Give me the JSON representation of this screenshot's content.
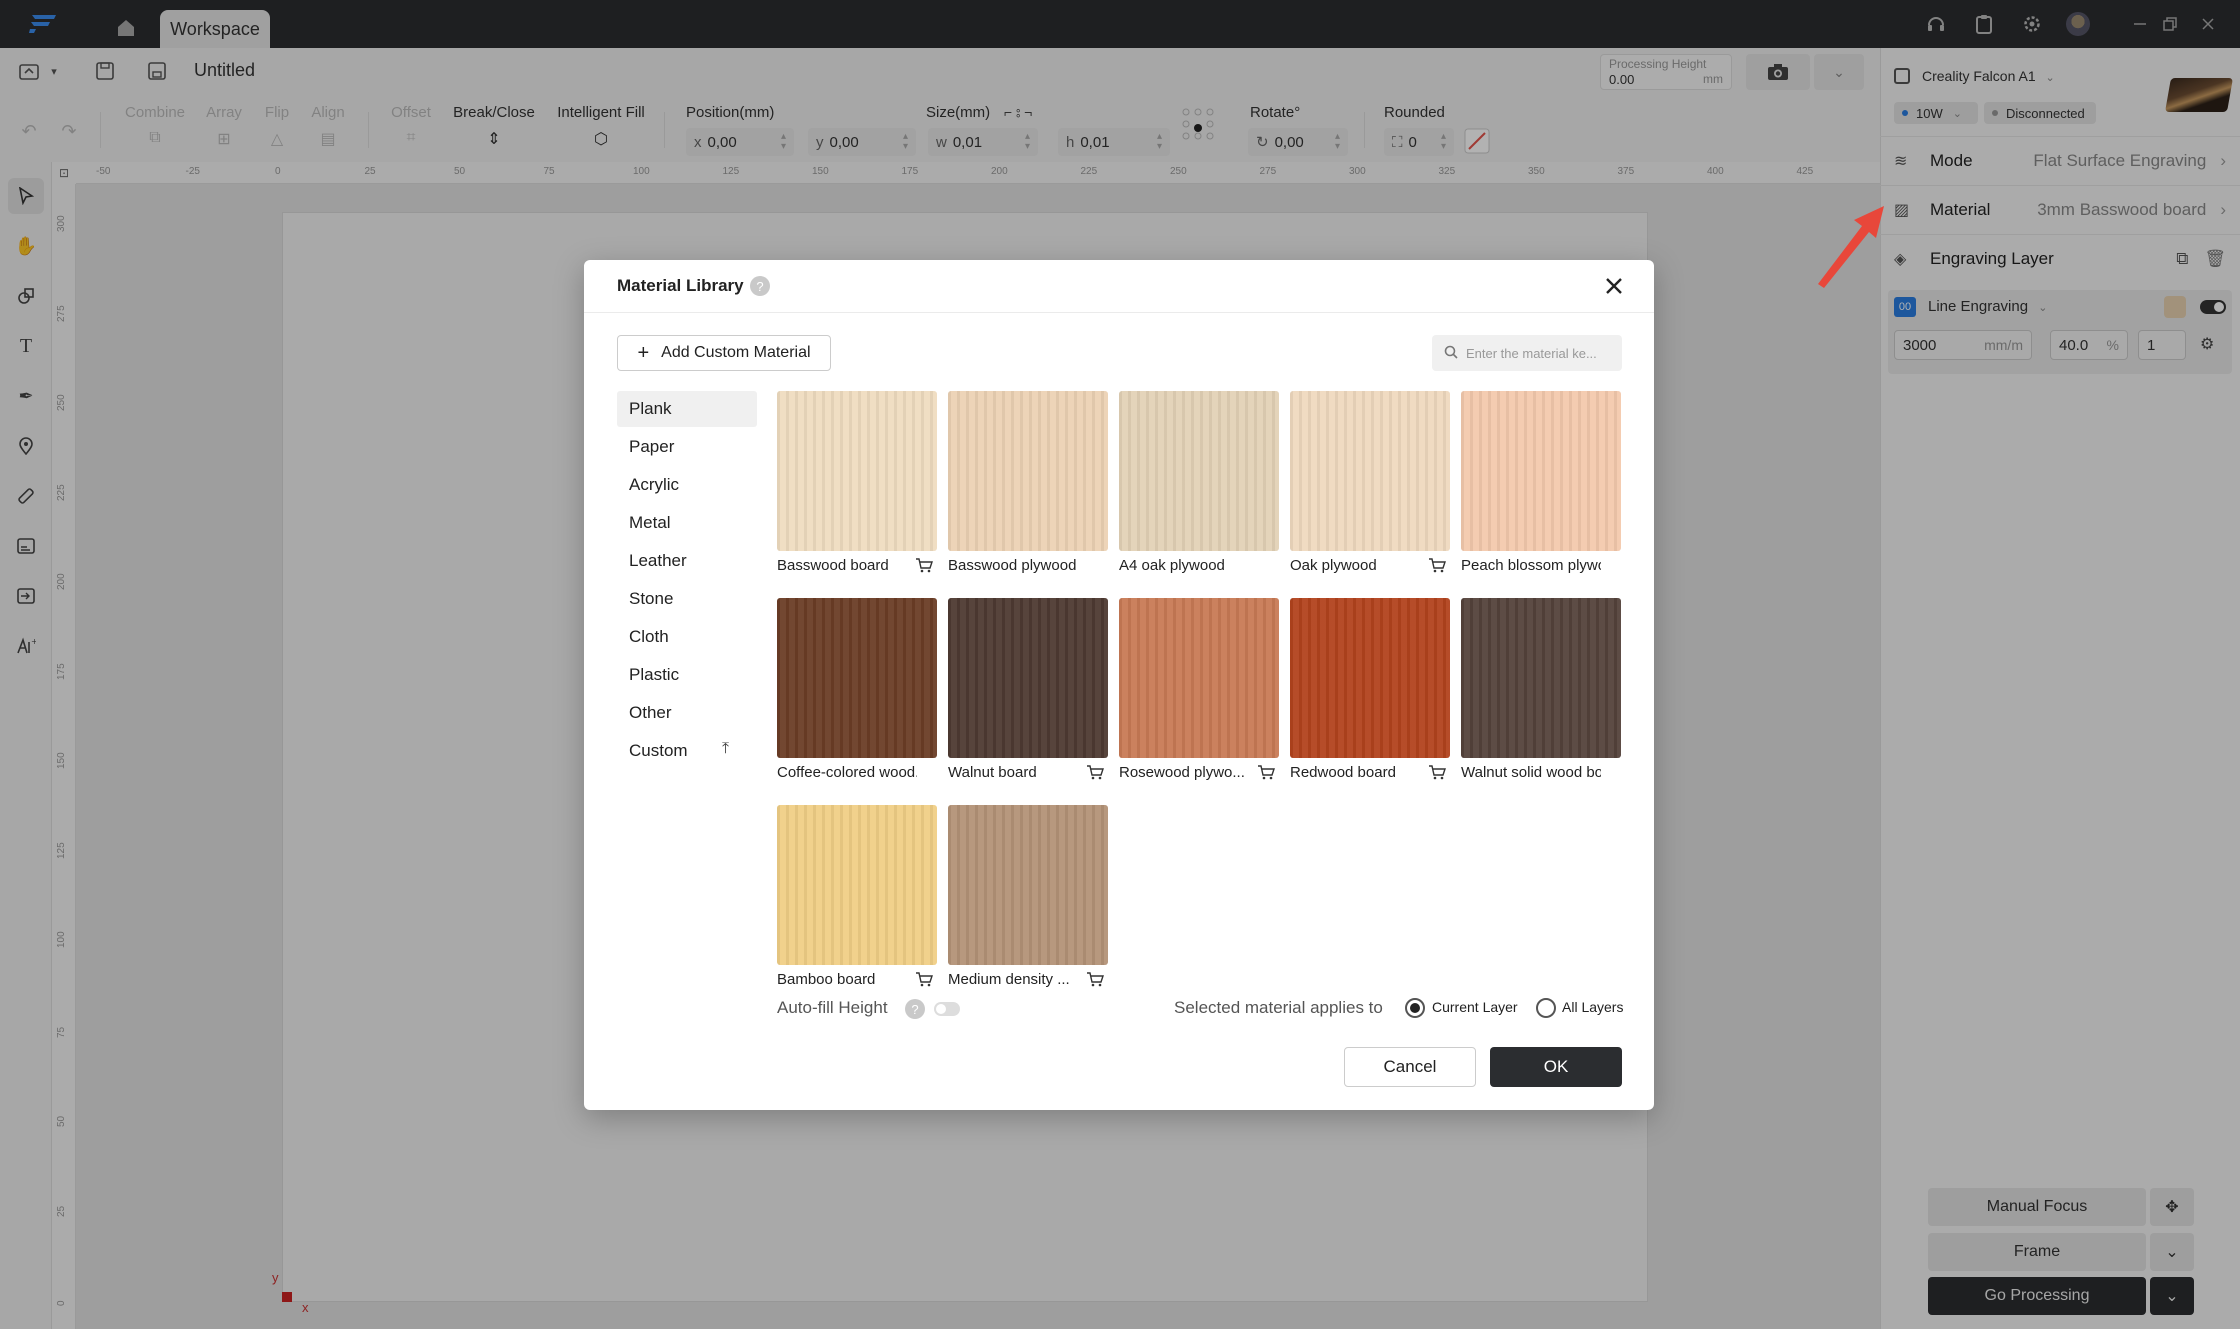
{
  "titlebar": {
    "tab": "Workspace",
    "icons": [
      "logo-icon",
      "home-icon",
      "headset-icon",
      "clipboard-icon",
      "gear-icon",
      "avatar",
      "minimize-icon",
      "restore-icon",
      "close-icon"
    ]
  },
  "file": {
    "title": "Untitled"
  },
  "processing_height": {
    "label": "Processing Height",
    "value": "0.00",
    "unit": "mm"
  },
  "tools": [
    {
      "label": "Combine",
      "enabled": false
    },
    {
      "label": "Array",
      "enabled": false
    },
    {
      "label": "Flip",
      "enabled": false
    },
    {
      "label": "Align",
      "enabled": false
    },
    {
      "label": "Offset",
      "enabled": false
    },
    {
      "label": "Break/Close",
      "enabled": true
    },
    {
      "label": "Intelligent Fill",
      "enabled": true
    }
  ],
  "props": {
    "position_label": "Position(mm)",
    "x_prefix": "x",
    "x_value": "0,00",
    "y_prefix": "y",
    "y_value": "0,00",
    "size_label": "Size(mm)",
    "w_prefix": "w",
    "w_value": "0,01",
    "h_prefix": "h",
    "h_value": "0,01",
    "rotate_label": "Rotate°",
    "rotate_value": "0,00",
    "rounded_label": "Rounded",
    "rounded_value": "0"
  },
  "ruler": {
    "top": [
      "-50",
      "-25",
      "0",
      "25",
      "50",
      "75",
      "100",
      "125",
      "150",
      "175",
      "200",
      "225",
      "250",
      "275",
      "300",
      "325",
      "350",
      "375",
      "400",
      "425"
    ],
    "left": [
      "300",
      "275",
      "250",
      "225",
      "200",
      "175",
      "150",
      "125",
      "100",
      "75",
      "50",
      "25",
      "0"
    ]
  },
  "canvas": {
    "axis_y": "y",
    "axis_x": "x"
  },
  "right_panel": {
    "machine": "Creality Falcon A1",
    "power": "10W",
    "status": "Disconnected",
    "mode_label": "Mode",
    "mode_value": "Flat Surface Engraving",
    "material_label": "Material",
    "material_value": "3mm Basswood board",
    "layer_header": "Engraving Layer",
    "layer": {
      "badge": "00",
      "name": "Line Engraving",
      "speed": "3000",
      "speed_unit": "mm/m",
      "power": "40.0",
      "power_unit": "%",
      "passes": "1"
    },
    "manual_focus": "Manual Focus",
    "frame": "Frame",
    "go": "Go Processing"
  },
  "modal": {
    "title": "Material Library",
    "add_custom": "Add Custom Material",
    "search_placeholder": "Enter the material ke...",
    "categories": [
      "Plank",
      "Paper",
      "Acrylic",
      "Metal",
      "Leather",
      "Stone",
      "Cloth",
      "Plastic",
      "Other",
      "Custom"
    ],
    "materials": [
      {
        "name": "Basswood board",
        "cart": true,
        "color": "#efdcc0"
      },
      {
        "name": "Basswood plywood",
        "cart": false,
        "color": "#ecd2b4"
      },
      {
        "name": "A4 oak plywood",
        "cart": false,
        "color": "#e3d2b6"
      },
      {
        "name": "Oak plywood",
        "cart": true,
        "color": "#efd9bf"
      },
      {
        "name": "Peach blossom plywo...",
        "cart": false,
        "color": "#f3c9ad"
      },
      {
        "name": "Coffee-colored wood...",
        "cart": false,
        "color": "#6b3d26"
      },
      {
        "name": "Walnut board",
        "cart": true,
        "color": "#4e3a32"
      },
      {
        "name": "Rosewood plywo...",
        "cart": true,
        "color": "#c87a55"
      },
      {
        "name": "Redwood board",
        "cart": true,
        "color": "#b2431e"
      },
      {
        "name": "Walnut solid wood bo...",
        "cart": false,
        "color": "#54423b"
      },
      {
        "name": "Bamboo board",
        "cart": true,
        "color": "#f0cf86"
      },
      {
        "name": "Medium density ...",
        "cart": true,
        "color": "#b39277"
      }
    ],
    "autofill_label": "Auto-fill Height",
    "applies_label": "Selected material applies to",
    "option_current": "Current Layer",
    "option_all": "All Layers",
    "cancel": "Cancel",
    "ok": "OK"
  }
}
